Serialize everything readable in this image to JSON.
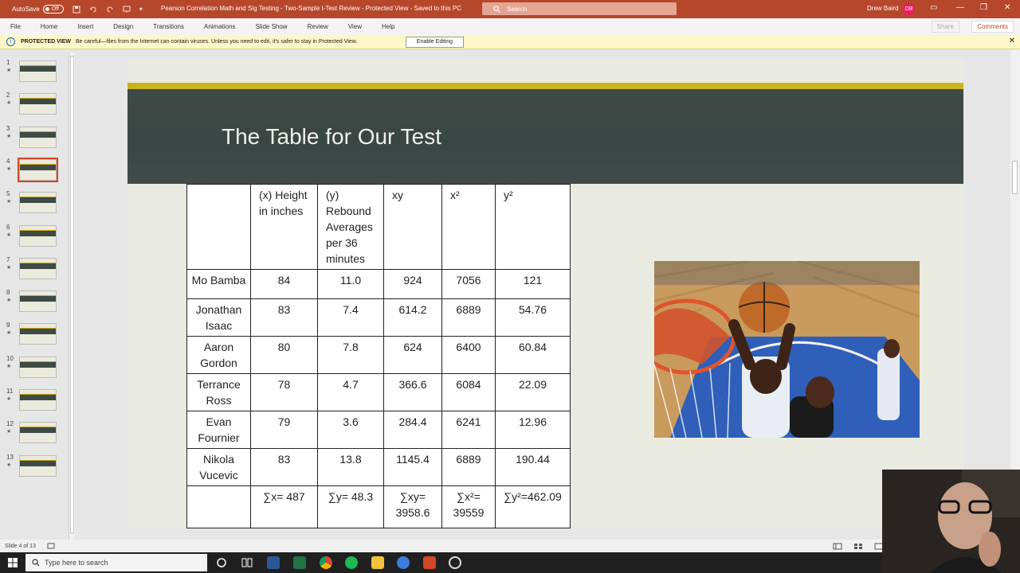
{
  "window": {
    "autosave_label": "AutoSave",
    "autosave_state": "Off",
    "title": "Pearson Correlation Math and Sig Testing - Two-Sample t-Test Review  -  Protected View  -  Saved to this PC",
    "search_placeholder": "Search",
    "user_name": "Drew Baird",
    "user_initials": "DB",
    "controls": {
      "ribbon_display": "▭",
      "minimize": "—",
      "restore": "❐",
      "close": "✕"
    }
  },
  "ribbon": {
    "tabs": [
      "File",
      "Home",
      "Insert",
      "Design",
      "Transitions",
      "Animations",
      "Slide Show",
      "Review",
      "View",
      "Help"
    ],
    "share_label": "Share",
    "comments_label": "Comments"
  },
  "protected_view": {
    "title": "PROTECTED VIEW",
    "message": "Be careful—files from the Internet can contain viruses. Unless you need to edit, it's safer to stay in Protected View.",
    "button_label": "Enable Editing",
    "close": "✕"
  },
  "thumbnails": {
    "selected": 4,
    "numbers": [
      "1",
      "2",
      "3",
      "4",
      "5",
      "6",
      "7",
      "8",
      "9",
      "10",
      "11",
      "12",
      "13"
    ],
    "star": "★"
  },
  "slide": {
    "title": "The Table for Our Test",
    "table": {
      "headers": [
        "",
        "(x) Height in inches",
        "(y) Rebound Averages per 36 minutes",
        "xy",
        "x²",
        "y²"
      ],
      "rows": [
        [
          "Mo Bamba",
          "84",
          "11.0",
          "924",
          "7056",
          "121"
        ],
        [
          "Jonathan Isaac",
          "83",
          "7.4",
          "614.2",
          "6889",
          "54.76"
        ],
        [
          "Aaron Gordon",
          "80",
          "7.8",
          "624",
          "6400",
          "60.84"
        ],
        [
          "Terrance Ross",
          "78",
          "4.7",
          "366.6",
          "6084",
          "22.09"
        ],
        [
          "Evan Fournier",
          "79",
          "3.6",
          "284.4",
          "6241",
          "12.96"
        ],
        [
          "Nikola Vucevic",
          "83",
          "13.8",
          "1145.4",
          "6889",
          "190.44"
        ]
      ],
      "totals": [
        "",
        "∑x= 487",
        "∑y= 48.3",
        "∑xy= 3958.6",
        "∑x²= 39559",
        "∑y²=462.09"
      ]
    }
  },
  "status": {
    "slide_info": "Slide 4 of 13"
  },
  "taskbar": {
    "search_placeholder": "Type here to search"
  }
}
